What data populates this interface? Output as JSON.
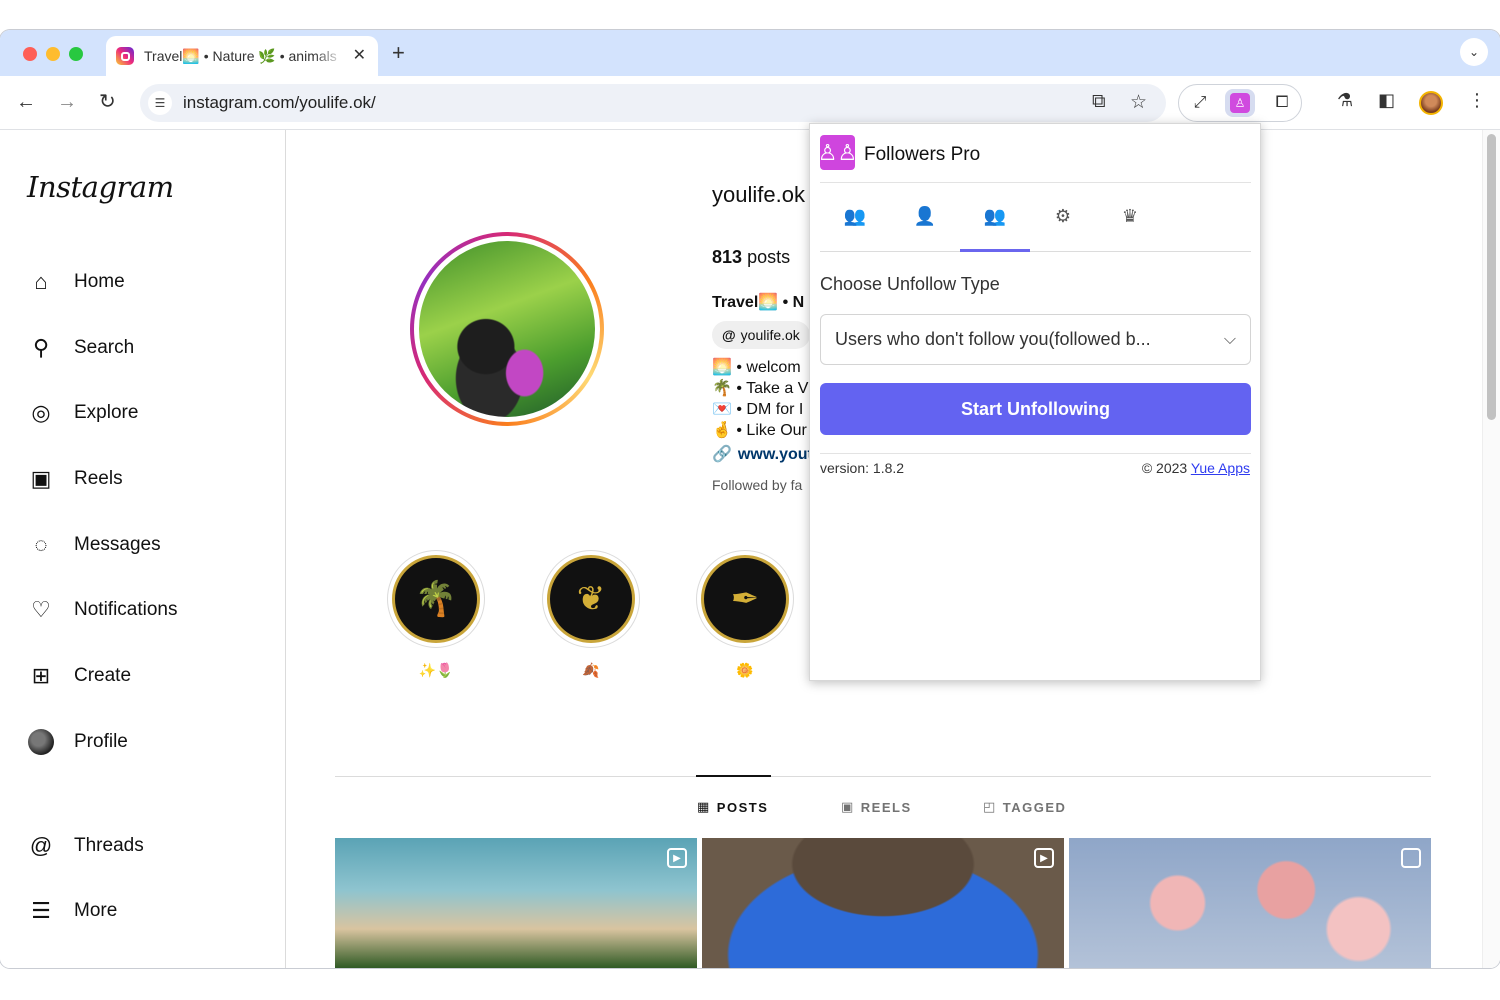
{
  "browser": {
    "tab_title": "Travel🌅 • Nature 🌿 • animals",
    "new_tab_icon": "plus-icon",
    "url": "instagram.com/youlife.ok/"
  },
  "instagram": {
    "logo": "Instagram",
    "nav": [
      {
        "label": "Home",
        "icon": "home-icon"
      },
      {
        "label": "Search",
        "icon": "search-icon"
      },
      {
        "label": "Explore",
        "icon": "explore-icon"
      },
      {
        "label": "Reels",
        "icon": "reels-icon"
      },
      {
        "label": "Messages",
        "icon": "messages-icon"
      },
      {
        "label": "Notifications",
        "icon": "heart-icon"
      },
      {
        "label": "Create",
        "icon": "plus-square-icon"
      },
      {
        "label": "Profile",
        "icon": "avatar"
      },
      {
        "label": "Threads",
        "icon": "threads-icon"
      },
      {
        "label": "More",
        "icon": "menu-icon"
      }
    ],
    "profile": {
      "username": "youlife.ok",
      "posts_count": "813",
      "posts_label": "posts",
      "bio_name": "Travel🌅 • N",
      "threads_handle": "youlife.ok",
      "bio_lines": [
        "🌅 • welcom",
        "🌴 • Take a V",
        "💌 • DM for I",
        "🤞 • Like Our"
      ],
      "link": "www.yout",
      "followed_by": "Followed by fa"
    },
    "highlights": [
      {
        "label": "✨🌷"
      },
      {
        "label": "🍂"
      },
      {
        "label": "🌼"
      }
    ],
    "profile_tabs": [
      {
        "label": "POSTS",
        "icon": "grid-icon",
        "active": true
      },
      {
        "label": "REELS",
        "icon": "reels-icon",
        "active": false
      },
      {
        "label": "TAGGED",
        "icon": "tagged-icon",
        "active": false
      }
    ]
  },
  "extension_popup": {
    "title": "Followers Pro",
    "tabs": [
      {
        "icon": "group-icon"
      },
      {
        "icon": "users-icon"
      },
      {
        "icon": "unfollow-users-icon",
        "selected": true
      },
      {
        "icon": "gear-icon"
      },
      {
        "icon": "crown-icon"
      }
    ],
    "choose_label": "Choose Unfollow Type",
    "select_value": "Users who don't follow you(followed b...",
    "start_button": "Start Unfollowing",
    "version": "version: 1.8.2",
    "copyright": "© 2023",
    "company": "Yue Apps"
  },
  "colors": {
    "tab_strip": "#d3e3fd",
    "primary_button": "#6363f1",
    "extension_brand": "#cf45de"
  }
}
